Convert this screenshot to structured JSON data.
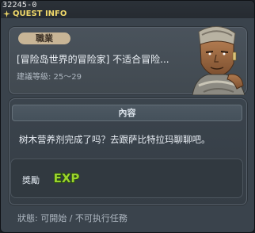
{
  "window": {
    "id": "32245-0",
    "title": "QUEST INFO",
    "colors": {
      "title": "#f1d96a",
      "badge": "#c8b596",
      "exp": "#9bd22d"
    },
    "title_icon": "sparkle-icon"
  },
  "quest": {
    "job_label": "職業",
    "name": "[冒险岛世界的冒险家] 不适合冒险...",
    "level": "建議等級: 25～29",
    "npc_icon": "npc-portrait-icon"
  },
  "content": {
    "header": "內容",
    "description": "树木营养剂完成了吗？去跟萨比特拉玛聊聊吧。"
  },
  "reward": {
    "label": "獎勵",
    "exp_text": "EXP",
    "exp_icon": "exp-icon"
  },
  "status": {
    "text": "狀態: 可開始 / 不可执行任務"
  }
}
